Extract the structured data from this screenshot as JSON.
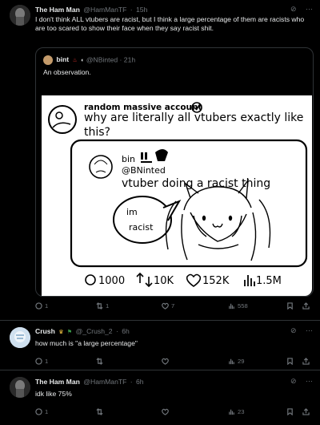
{
  "post1": {
    "author": "The Ham Man",
    "handle": "@HamManTF",
    "time": "15h",
    "text": "I don't think ALL vtubers are racist, but I think a large percentage of them are racists who are too scared to show their face when they say racist shit.",
    "quote": {
      "author": "bint",
      "handle": "@NBinted",
      "time": "21h",
      "text": "An observation.",
      "meme": {
        "top_account": "random massive account",
        "top_text_line1": "why are literally all vtubers exactly like",
        "top_text_line2": "this?",
        "inner_name": "bin",
        "inner_handle": "@BNinted",
        "inner_text": "vtuber doing a racist thing",
        "bubble_line1": "im",
        "bubble_line2": "racist",
        "stat_replies": "1000",
        "stat_retweets": "10K",
        "stat_likes": "152K",
        "stat_views": "1.5M"
      }
    },
    "replies": "1",
    "retweets": "1",
    "likes": "7",
    "views": "558"
  },
  "post2": {
    "author": "Crush",
    "handle": "@_Crush_2",
    "time": "6h",
    "text": "how much is \"a large percentage\"",
    "replies": "1",
    "retweets": "",
    "likes": "",
    "views": "29"
  },
  "post3": {
    "author": "The Ham Man",
    "handle": "@HamManTF",
    "time": "6h",
    "text": "idk like 75%",
    "replies": "1",
    "retweets": "",
    "likes": "",
    "views": "23"
  },
  "sep": "·",
  "more_glyph": "···",
  "colors": {
    "bg": "#000000",
    "text": "#e7e9ea",
    "muted": "#71767b",
    "border": "#2f3336"
  }
}
